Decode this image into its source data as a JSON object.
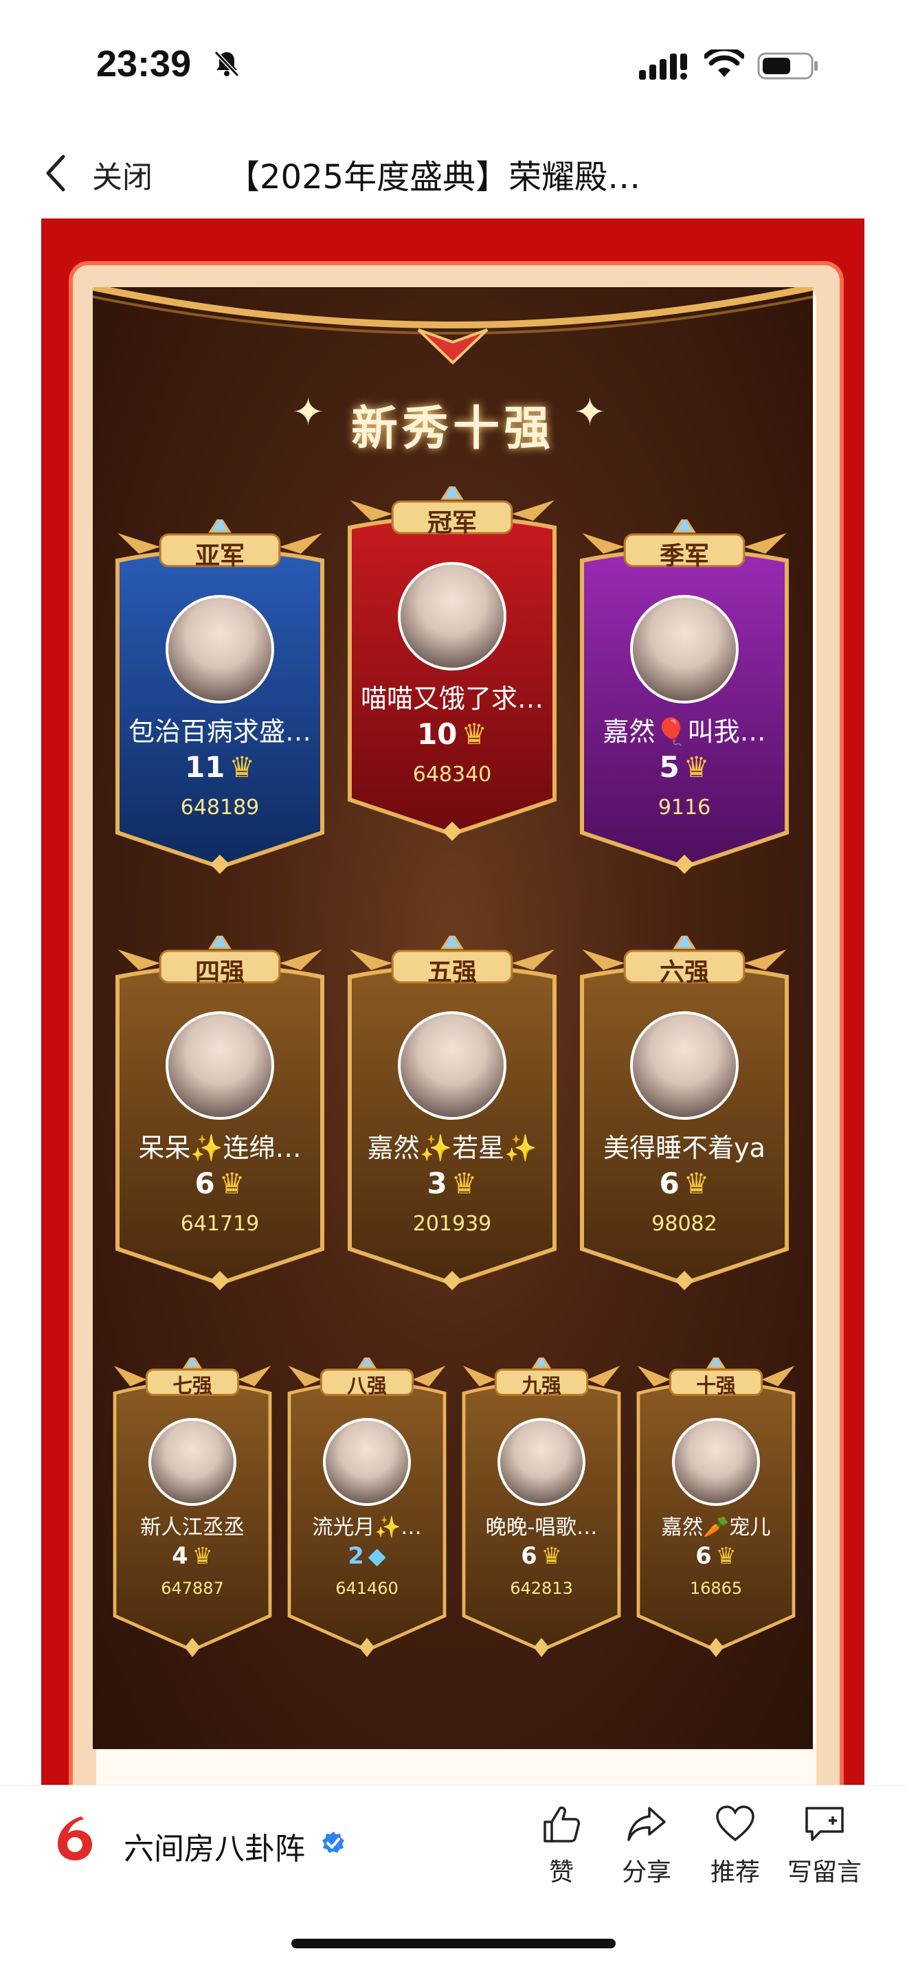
{
  "status_bar": {
    "time": "23:39"
  },
  "nav": {
    "close_label": "关闭",
    "title": "【2025年度盛典】荣耀殿…"
  },
  "poster": {
    "title": "新秀十强",
    "top3": [
      {
        "rank": "亚军",
        "name": "包治百病求盛…",
        "count": "11",
        "count_icon": "crown-icon",
        "score": "648189",
        "theme": "blue"
      },
      {
        "rank": "冠军",
        "name": "喵喵又饿了求…",
        "count": "10",
        "count_icon": "crown-icon",
        "score": "648340",
        "theme": "red"
      },
      {
        "rank": "季军",
        "name": "嘉然🎈叫我…",
        "count": "5",
        "count_icon": "crown-icon",
        "score": "9116",
        "theme": "purple"
      }
    ],
    "mid3": [
      {
        "rank": "四强",
        "name": "呆呆✨连绵…",
        "count": "6",
        "count_icon": "crown-icon",
        "score": "641719"
      },
      {
        "rank": "五强",
        "name": "嘉然✨若星✨",
        "count": "3",
        "count_icon": "crown-icon",
        "score": "201939"
      },
      {
        "rank": "六强",
        "name": "美得睡不着ya",
        "count": "6",
        "count_icon": "crown-icon",
        "score": "98082"
      }
    ],
    "bottom4": [
      {
        "rank": "七强",
        "name": "新人江丞丞",
        "count": "4",
        "count_icon": "crown-icon",
        "score": "647887"
      },
      {
        "rank": "八强",
        "name": "流光月✨…",
        "count": "2",
        "count_icon": "diamond-icon",
        "score": "641460"
      },
      {
        "rank": "九强",
        "name": "晚晚-唱歌…",
        "count": "6",
        "count_icon": "crown-icon",
        "score": "642813"
      },
      {
        "rank": "十强",
        "name": "嘉然🥕宠儿",
        "count": "6",
        "count_icon": "crown-icon",
        "score": "16865"
      }
    ]
  },
  "footer": {
    "brand_name": "六间房八卦阵",
    "actions": [
      {
        "label": "赞",
        "icon": "thumbs-up-icon"
      },
      {
        "label": "分享",
        "icon": "share-icon"
      },
      {
        "label": "推荐",
        "icon": "heart-icon"
      },
      {
        "label": "写留言",
        "icon": "comment-icon"
      }
    ]
  },
  "colors": {
    "article_red": "#c50b0b",
    "poster_brown": "#4a2412",
    "gold": "#e7b25a",
    "blue_card": "#1a3f86",
    "red_card": "#a8121b",
    "purple_card": "#7a1e8f",
    "verified_blue": "#2d83f2"
  }
}
